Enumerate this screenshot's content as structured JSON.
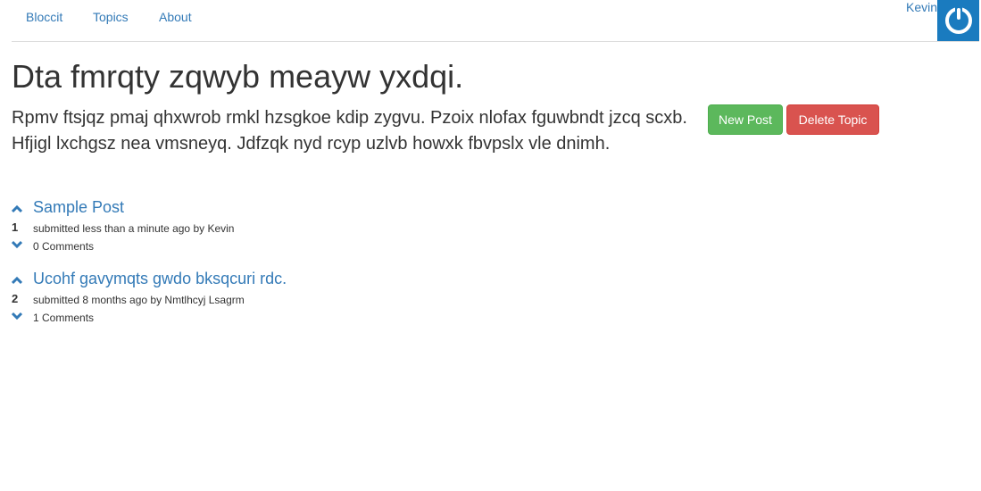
{
  "nav": {
    "brand": "Bloccit",
    "links": [
      "Topics",
      "About"
    ],
    "user": "Kevin"
  },
  "topic": {
    "title": "Dta fmrqty zqwyb meayw yxdqi.",
    "description": "Rpmv ftsjqz pmaj qhxwrob rmkl hzsgkoe kdip zygvu. Pzoix nlofax fguwbndt jzcq scxb. Hfjigl lxchgsz nea vmsneyq. Jdfzqk nyd rcyp uzlvb howxk fbvpslx vle dnimh."
  },
  "buttons": {
    "new_post": "New Post",
    "delete_topic": "Delete Topic"
  },
  "posts": [
    {
      "votes": "1",
      "title": "Sample Post",
      "meta": "submitted less than a minute ago by Kevin",
      "comments": "0 Comments"
    },
    {
      "votes": "2",
      "title": "Ucohf gavymqts gwdo bksqcuri rdc.",
      "meta": "submitted 8 months ago by Nmtlhcyj Lsagrm",
      "comments": "1 Comments"
    }
  ],
  "colors": {
    "link": "#337ab7",
    "success": "#5cb85c",
    "danger": "#d9534f",
    "avatar": "#1a7bbf"
  },
  "icons": {
    "avatar": "power-icon",
    "vote_up": "chevron-up-icon",
    "vote_down": "chevron-down-icon"
  }
}
